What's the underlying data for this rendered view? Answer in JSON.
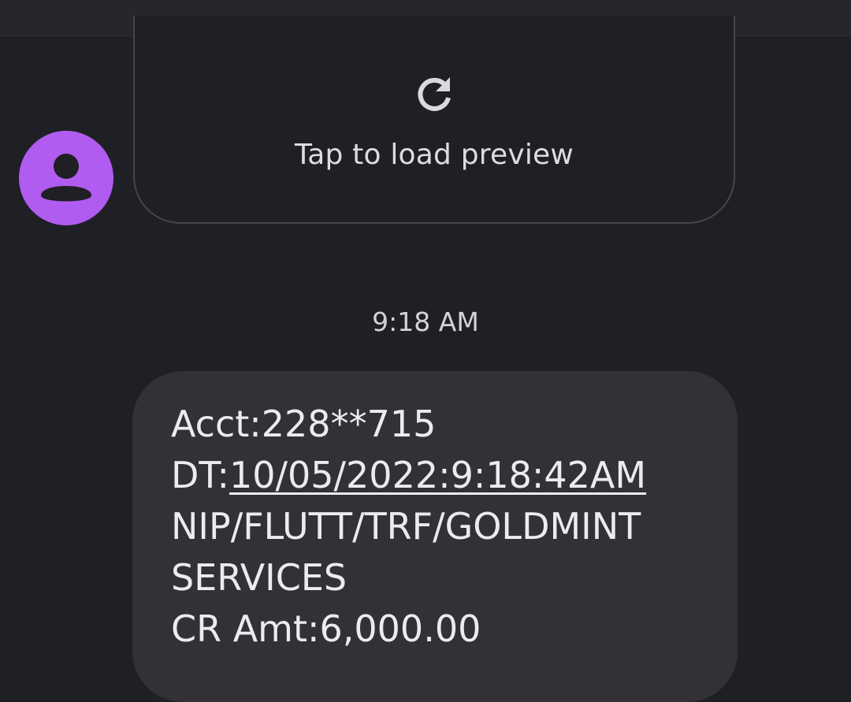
{
  "preview": {
    "icon": "reload-icon",
    "label": "Tap to load preview"
  },
  "avatar": {
    "icon": "person-icon",
    "color": "#b05cf0"
  },
  "timestamp": "9:18 AM",
  "message": {
    "line1": "Acct:228**715",
    "line2_prefix": "DT:",
    "line2_link": "10/05/2022:9:18:42AM",
    "line3": "NIP/FLUTT/TRF/GOLDMINT",
    "line4": "SERVICES",
    "line5": "CR Amt:6,000.00"
  }
}
